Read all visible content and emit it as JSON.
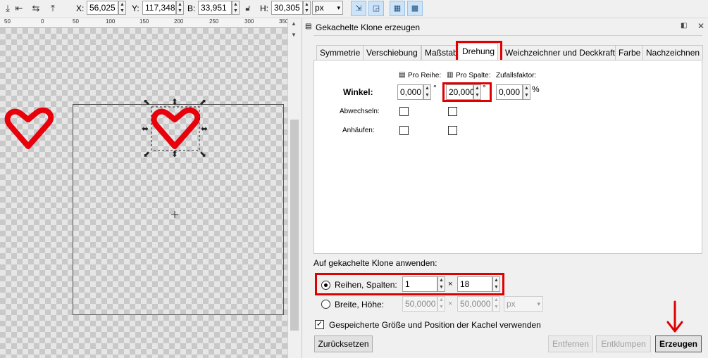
{
  "toolbar": {
    "x_label": "X:",
    "x_value": "56,025",
    "y_label": "Y:",
    "y_value": "117,348",
    "w_label": "B:",
    "w_value": "33,951",
    "h_label": "H:",
    "h_value": "30,305",
    "unit": "px"
  },
  "ruler": {
    "ticks": [
      "50",
      "0",
      "50",
      "100",
      "150",
      "200",
      "250",
      "300",
      "350"
    ]
  },
  "panel": {
    "title": "Gekachelte Klone erzeugen",
    "tabs": [
      "Symmetrie",
      "Verschiebung",
      "Maßstab",
      "Drehung",
      "Weichzeichner und Deckkraft",
      "Farbe",
      "Nachzeichnen"
    ],
    "active_tab": "Drehung",
    "col_per_row": "Pro Reihe:",
    "col_per_col": "Pro Spalte:",
    "col_random": "Zufallsfaktor:",
    "angle_label": "Winkel:",
    "angle_row": "0,000",
    "angle_col": "20,000",
    "angle_random": "0,000",
    "degree": "°",
    "percent": "%",
    "alternate_label": "Abwechseln:",
    "cumulate_label": "Anhäufen:",
    "apply_label": "Auf gekachelte Klone anwenden:",
    "rows_cols_label": "Reihen, Spalten:",
    "rows_value": "1",
    "cols_value": "18",
    "times": "×",
    "width_height_label": "Breite, Höhe:",
    "width_value": "50,0000",
    "height_value": "50,0000",
    "size_unit": "px",
    "saved_size_label": "Gespeicherte Größe und Position der Kachel verwenden",
    "reset_button": "Zurücksetzen",
    "remove_button": "Entfernen",
    "unclump_button": "Entklumpen",
    "create_button": "Erzeugen"
  },
  "colors": {
    "highlight": "#e00000",
    "heart": "#e8000b"
  }
}
